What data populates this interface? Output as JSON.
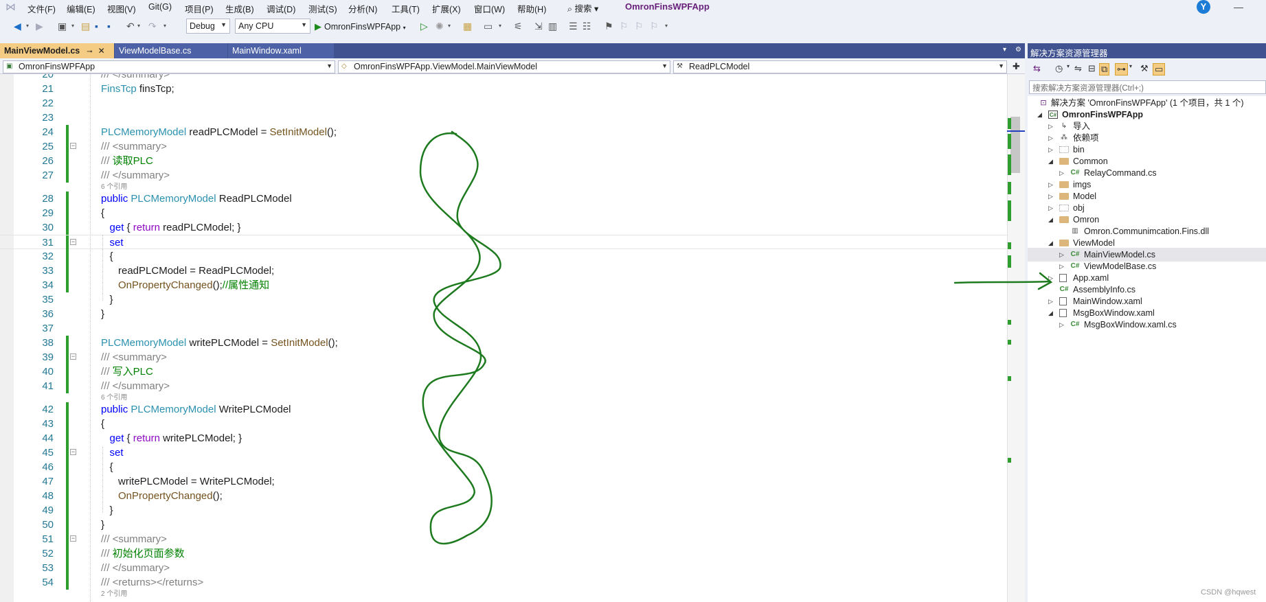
{
  "menu": {
    "items": [
      "文件(F)",
      "编辑(E)",
      "视图(V)",
      "Git(G)",
      "项目(P)",
      "生成(B)",
      "调试(D)",
      "测试(S)",
      "分析(N)",
      "工具(T)",
      "扩展(X)",
      "窗口(W)",
      "帮助(H)"
    ],
    "search": "搜索",
    "app_title": "OmronFinsWPFApp",
    "avatar": "Y"
  },
  "toolbar": {
    "config": "Debug",
    "platform": "Any CPU",
    "run_target": "OmronFinsWPFApp"
  },
  "tabs": [
    {
      "label": "MainViewModel.cs",
      "active": true
    },
    {
      "label": "ViewModelBase.cs",
      "active": false
    },
    {
      "label": "MainWindow.xaml",
      "active": false
    }
  ],
  "navbar": {
    "project": "OmronFinsWPFApp",
    "type": "OmronFinsWPFApp.ViewModel.MainViewModel",
    "member": "ReadPLCModel"
  },
  "code": {
    "lines": [
      {
        "n": "20",
        "tokens": [
          [
            "dc",
            "/// </summary>"
          ]
        ]
      },
      {
        "n": "21",
        "tokens": [
          [
            "ty",
            "FinsTcp"
          ],
          [
            "",
            " finsTcp;"
          ]
        ]
      },
      {
        "n": "22",
        "tokens": []
      },
      {
        "n": "23",
        "tokens": []
      },
      {
        "n": "24",
        "tokens": [
          [
            "ty",
            "PLCMemoryModel"
          ],
          [
            "",
            " readPLCModel = "
          ],
          [
            "mt",
            "SetInitModel"
          ],
          [
            "",
            "();"
          ]
        ]
      },
      {
        "n": "25",
        "tokens": [
          [
            "dc",
            "/// <summary>"
          ]
        ]
      },
      {
        "n": "26",
        "tokens": [
          [
            "dc",
            "/// "
          ],
          [
            "cm",
            "读取PLC"
          ]
        ]
      },
      {
        "n": "27",
        "tokens": [
          [
            "dc",
            "/// </summary>"
          ]
        ]
      },
      {
        "n": "28",
        "tokens": [
          [
            "kw",
            "public"
          ],
          [
            "",
            " "
          ],
          [
            "ty",
            "PLCMemoryModel"
          ],
          [
            "",
            " ReadPLCModel"
          ]
        ]
      },
      {
        "n": "29",
        "tokens": [
          [
            "",
            "{"
          ]
        ]
      },
      {
        "n": "30",
        "tokens": [
          [
            "",
            "   "
          ],
          [
            "kw",
            "get"
          ],
          [
            "",
            " { "
          ],
          [
            "kw2",
            "return"
          ],
          [
            "",
            " readPLCModel; }"
          ]
        ]
      },
      {
        "n": "31",
        "tokens": [
          [
            "",
            "   "
          ],
          [
            "kw",
            "set"
          ]
        ]
      },
      {
        "n": "32",
        "tokens": [
          [
            "",
            "   {"
          ]
        ]
      },
      {
        "n": "33",
        "tokens": [
          [
            "",
            "      readPLCModel = ReadPLCModel;"
          ]
        ]
      },
      {
        "n": "34",
        "tokens": [
          [
            "",
            "      "
          ],
          [
            "mt",
            "OnPropertyChanged"
          ],
          [
            "",
            "();"
          ],
          [
            "cm",
            "//属性通知"
          ]
        ]
      },
      {
        "n": "35",
        "tokens": [
          [
            "",
            "   }"
          ]
        ]
      },
      {
        "n": "36",
        "tokens": [
          [
            "",
            "}"
          ]
        ]
      },
      {
        "n": "37",
        "tokens": []
      },
      {
        "n": "38",
        "tokens": [
          [
            "ty",
            "PLCMemoryModel"
          ],
          [
            "",
            " writePLCModel = "
          ],
          [
            "mt",
            "SetInitModel"
          ],
          [
            "",
            "();"
          ]
        ]
      },
      {
        "n": "39",
        "tokens": [
          [
            "dc",
            "/// <summary>"
          ]
        ]
      },
      {
        "n": "40",
        "tokens": [
          [
            "dc",
            "/// "
          ],
          [
            "cm",
            "写入PLC"
          ]
        ]
      },
      {
        "n": "41",
        "tokens": [
          [
            "dc",
            "/// </summary>"
          ]
        ]
      },
      {
        "n": "42",
        "tokens": [
          [
            "kw",
            "public"
          ],
          [
            "",
            " "
          ],
          [
            "ty",
            "PLCMemoryModel"
          ],
          [
            "",
            " WritePLCModel"
          ]
        ]
      },
      {
        "n": "43",
        "tokens": [
          [
            "",
            "{"
          ]
        ]
      },
      {
        "n": "44",
        "tokens": [
          [
            "",
            "   "
          ],
          [
            "kw",
            "get"
          ],
          [
            "",
            " { "
          ],
          [
            "kw2",
            "return"
          ],
          [
            "",
            " writePLCModel; }"
          ]
        ]
      },
      {
        "n": "45",
        "tokens": [
          [
            "",
            "   "
          ],
          [
            "kw",
            "set"
          ]
        ]
      },
      {
        "n": "46",
        "tokens": [
          [
            "",
            "   {"
          ]
        ]
      },
      {
        "n": "47",
        "tokens": [
          [
            "",
            "      writePLCModel = WritePLCModel;"
          ]
        ]
      },
      {
        "n": "48",
        "tokens": [
          [
            "",
            "      "
          ],
          [
            "mt",
            "OnPropertyChanged"
          ],
          [
            "",
            "();"
          ]
        ]
      },
      {
        "n": "49",
        "tokens": [
          [
            "",
            "   }"
          ]
        ]
      },
      {
        "n": "50",
        "tokens": [
          [
            "",
            "}"
          ]
        ]
      },
      {
        "n": "51",
        "tokens": [
          [
            "dc",
            "/// <summary>"
          ]
        ]
      },
      {
        "n": "52",
        "tokens": [
          [
            "dc",
            "/// "
          ],
          [
            "cm",
            "初始化页面参数"
          ]
        ]
      },
      {
        "n": "53",
        "tokens": [
          [
            "dc",
            "/// </summary>"
          ]
        ]
      },
      {
        "n": "54",
        "tokens": [
          [
            "dc",
            "/// <returns></returns>"
          ]
        ]
      }
    ],
    "ref_hints": [
      "6 个引用",
      "6 个引用",
      "2 个引用"
    ]
  },
  "solution_explorer": {
    "title": "解决方案资源管理器",
    "search_placeholder": "搜索解决方案资源管理器(Ctrl+;)",
    "items": [
      {
        "label": "解决方案 'OmronFinsWPFApp' (1 个项目，共 1 个)",
        "icon": "solution-icon"
      },
      {
        "label": "OmronFinsWPFApp",
        "icon": "project-icon"
      },
      {
        "label": "导入",
        "icon": "import-icon"
      },
      {
        "label": "依赖项",
        "icon": "dependencies-icon"
      },
      {
        "label": "bin",
        "icon": "folder-icon"
      },
      {
        "label": "Common",
        "icon": "folder-icon"
      },
      {
        "label": "RelayCommand.cs",
        "icon": "csharp-file-icon"
      },
      {
        "label": "imgs",
        "icon": "folder-icon"
      },
      {
        "label": "Model",
        "icon": "folder-icon"
      },
      {
        "label": "obj",
        "icon": "folder-icon"
      },
      {
        "label": "Omron",
        "icon": "folder-icon"
      },
      {
        "label": "Omron.Communimcation.Fins.dll",
        "icon": "dll-icon"
      },
      {
        "label": "ViewModel",
        "icon": "folder-icon"
      },
      {
        "label": "MainViewModel.cs",
        "icon": "csharp-file-icon"
      },
      {
        "label": "ViewModelBase.cs",
        "icon": "csharp-file-icon"
      },
      {
        "label": "App.xaml",
        "icon": "xaml-file-icon"
      },
      {
        "label": "AssemblyInfo.cs",
        "icon": "csharp-file-icon"
      },
      {
        "label": "MainWindow.xaml",
        "icon": "xaml-file-icon"
      },
      {
        "label": "MsgBoxWindow.xaml",
        "icon": "xaml-file-icon"
      },
      {
        "label": "MsgBoxWindow.xaml.cs",
        "icon": "csharp-file-icon"
      }
    ]
  },
  "watermark": "CSDN @hqwest",
  "colors": {
    "tab_strip": "#405290",
    "active_tab": "#f5cc84",
    "annotation": "#1e7a1e",
    "change_margin": "#2e9e2e"
  }
}
